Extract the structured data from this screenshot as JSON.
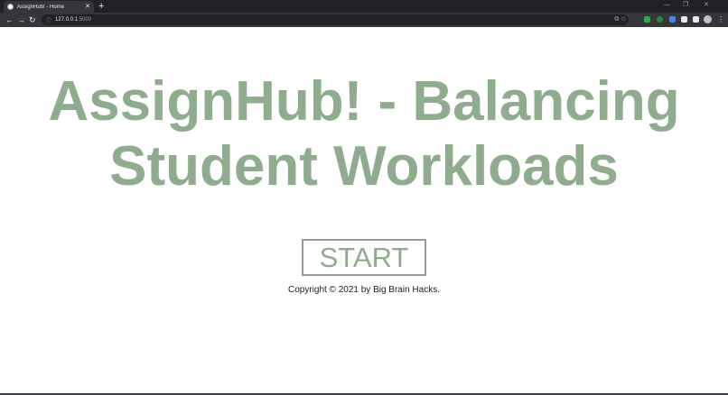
{
  "browser": {
    "tab_title": "AssignHub! - Home",
    "tab_close": "✕",
    "new_tab": "+",
    "window_controls": {
      "minimize": "—",
      "restore": "❐",
      "close": "✕"
    },
    "nav": {
      "back": "←",
      "forward": "→",
      "reload": "↻"
    },
    "address": {
      "host": "127.0.0.1",
      "port": ":5000",
      "info_icon": "ⓘ"
    },
    "omnibox_icons": [
      "cast-icon",
      "star-icon"
    ],
    "omnibox_right": "⧉  ☆",
    "extensions": [
      {
        "name": "shield-extension-icon",
        "color": "#34a853"
      },
      {
        "name": "grammar-extension-icon",
        "color": "#1e8e3e"
      },
      {
        "name": "video-extension-icon",
        "color": "#4285f4"
      },
      {
        "name": "puzzle-extensions-icon",
        "color": "#e8eaed"
      },
      {
        "name": "media-control-icon",
        "color": "#e8eaed"
      }
    ],
    "menu": "⋮"
  },
  "page": {
    "title": "AssignHub! - Balancing Student Workloads",
    "start_label": "START",
    "copyright": "Copyright © 2021 by Big Brain Hacks."
  },
  "colors": {
    "accent_green": "#8fac8e",
    "button_border": "#9a9a9a",
    "chrome_dark": "#202124",
    "chrome_toolbar": "#35363a"
  }
}
